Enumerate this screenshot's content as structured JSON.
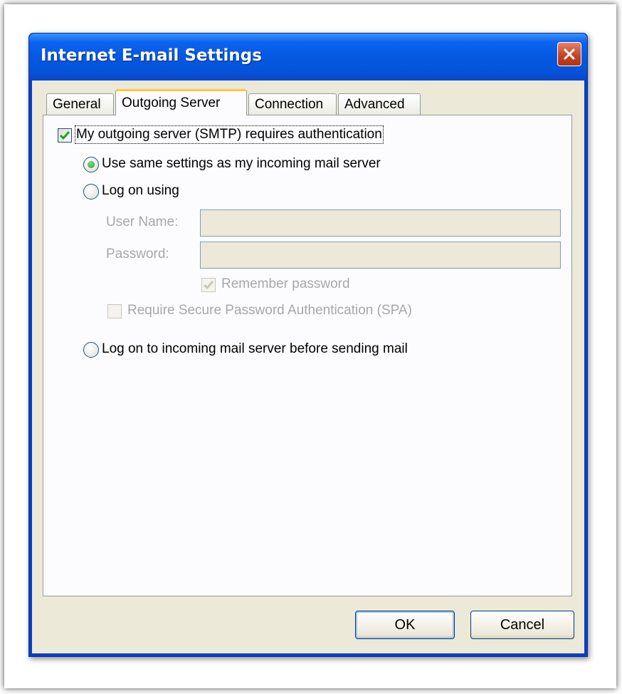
{
  "window": {
    "title": "Internet E-mail Settings"
  },
  "tabs": [
    {
      "label": "General",
      "active": false
    },
    {
      "label": "Outgoing Server",
      "active": true
    },
    {
      "label": "Connection",
      "active": false
    },
    {
      "label": "Advanced",
      "active": false
    }
  ],
  "smtp_auth": {
    "label": "My outgoing server (SMTP) requires authentication",
    "checked": true
  },
  "auth_options": {
    "same_settings_label": "Use same settings as my incoming mail server",
    "same_settings_selected": true,
    "log_on_using_label": "Log on using",
    "log_on_using_selected": false,
    "log_on_before_label": "Log on to incoming mail server before sending mail",
    "log_on_before_selected": false
  },
  "credentials": {
    "username_label": "User Name:",
    "username_value": "",
    "password_label": "Password:",
    "password_value": "",
    "remember_password_label": "Remember password",
    "remember_password_checked": true,
    "spa_label": "Require Secure Password Authentication (SPA)",
    "spa_checked": false
  },
  "buttons": {
    "ok": "OK",
    "cancel": "Cancel"
  },
  "colors": {
    "titlebar": "#0558e0",
    "dialog_face": "#ece9d8",
    "active_tab_accent": "#ffc83c",
    "check_green": "#21a121",
    "close_red": "#c2401f"
  }
}
